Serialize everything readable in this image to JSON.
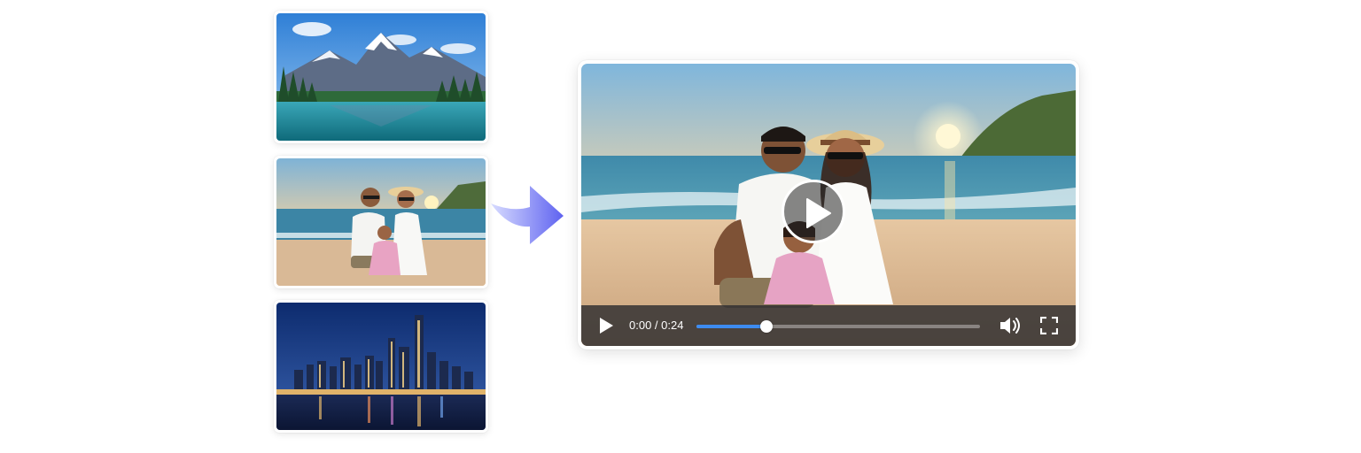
{
  "player": {
    "current_time": "0:00",
    "duration": "0:24",
    "time_separator": " / ",
    "progress_fraction": 0.247,
    "accent_color": "#3d8cf0"
  },
  "thumbnails": [
    {
      "scene": "mountain-lake"
    },
    {
      "scene": "family-beach-sunset"
    },
    {
      "scene": "city-skyline-night"
    }
  ],
  "icons": {
    "play": "play-icon",
    "volume": "volume-icon",
    "fullscreen": "fullscreen-icon",
    "arrow": "arrow-right-icon"
  }
}
